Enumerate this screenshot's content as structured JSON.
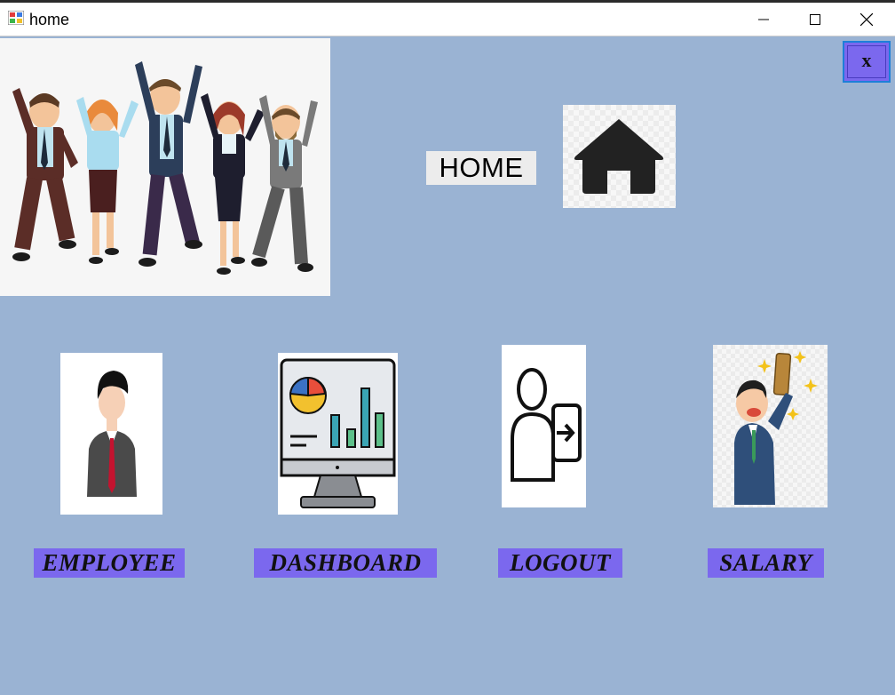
{
  "window": {
    "title": "home",
    "controls": [
      "minimize-icon",
      "maximize-icon",
      "close-icon"
    ]
  },
  "header": {
    "home_label": "HOME",
    "close_button_label": "x"
  },
  "tiles": [
    {
      "id": "employee",
      "label": "EMPLOYEE",
      "icon": "employee-icon"
    },
    {
      "id": "dashboard",
      "label": "DASHBOARD",
      "icon": "dashboard-monitor-icon"
    },
    {
      "id": "logout",
      "label": "LOGOUT",
      "icon": "logout-icon"
    },
    {
      "id": "salary",
      "label": "SALARY",
      "icon": "salary-celebration-icon"
    }
  ],
  "colors": {
    "background": "#9ab3d3",
    "label_bg": "#7b68ee",
    "close_border": "#1e7fd8"
  }
}
